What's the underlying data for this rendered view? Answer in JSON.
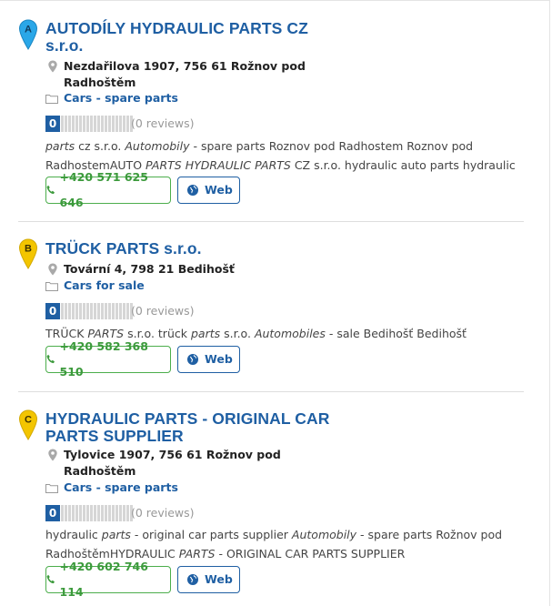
{
  "listings": [
    {
      "marker": "A",
      "marker_color": "#2aa7e8",
      "title_line1": "AUTODÍLY HYDRAULIC PARTS CZ",
      "title_line2": "s.r.o.",
      "address_line1": "Nezdařilova 1907, 756 61 Rožnov pod",
      "address_line2": "Radhoštěm",
      "category": "Cars - spare parts",
      "rating": "0",
      "reviews": "(0 reviews)",
      "desc": [
        [
          {
            "t": "parts",
            "i": true
          },
          {
            "t": " cz s.r.o. "
          },
          {
            "t": "Automobily",
            "i": true
          },
          {
            "t": " - spare parts Roznov pod Radhostem Roznov pod"
          }
        ],
        [
          {
            "t": "RadhostemAUTO "
          },
          {
            "t": "PARTS HYDRAULIC PARTS",
            "i": true
          },
          {
            "t": " CZ s.r.o. hydraulic auto parts hydraulic"
          }
        ]
      ],
      "phone": "+420 571 625 646",
      "web": "Web"
    },
    {
      "marker": "B",
      "marker_color": "#f3c500",
      "title_line1": "TRÜCK PARTS s.r.o.",
      "title_line2": "",
      "address_line1": "Tovární 4, 798 21 Bedihošť",
      "address_line2": "",
      "category": "Cars for sale",
      "rating": "0",
      "reviews": "(0 reviews)",
      "desc": [
        [
          {
            "t": "TRÜCK "
          },
          {
            "t": "PARTS",
            "i": true
          },
          {
            "t": " s.r.o. trück "
          },
          {
            "t": "parts",
            "i": true
          },
          {
            "t": " s.r.o. "
          },
          {
            "t": "Automobiles",
            "i": true
          },
          {
            "t": " - sale Bedihošť Bedihošť"
          }
        ]
      ],
      "phone": "+420 582 368 510",
      "web": "Web"
    },
    {
      "marker": "C",
      "marker_color": "#f3c500",
      "title_line1": "HYDRAULIC PARTS - ORIGINAL CAR",
      "title_line2": "PARTS SUPPLIER",
      "address_line1": "Tylovice 1907, 756 61 Rožnov pod",
      "address_line2": "Radhoštěm",
      "category": "Cars - spare parts",
      "rating": "0",
      "reviews": "(0 reviews)",
      "desc": [
        [
          {
            "t": "hydraulic "
          },
          {
            "t": "parts",
            "i": true
          },
          {
            "t": " - original car parts supplier "
          },
          {
            "t": "Automobily",
            "i": true
          },
          {
            "t": " - spare parts Rožnov pod"
          }
        ],
        [
          {
            "t": "RadhoštěmHYDRAULIC "
          },
          {
            "t": "PARTS",
            "i": true
          },
          {
            "t": " - ORIGINAL CAR PARTS SUPPLIER"
          }
        ]
      ],
      "phone": "+420 602 746 114",
      "web": "Web"
    }
  ],
  "icons": {
    "location": "map-pin-icon",
    "category": "folder-icon",
    "phone": "phone-icon",
    "web": "globe-icon"
  },
  "colors": {
    "link_blue": "#1f5fa3",
    "phone_green": "#3c9a3c",
    "marker_blue": "#2aa7e8",
    "marker_yellow": "#f3c500"
  }
}
